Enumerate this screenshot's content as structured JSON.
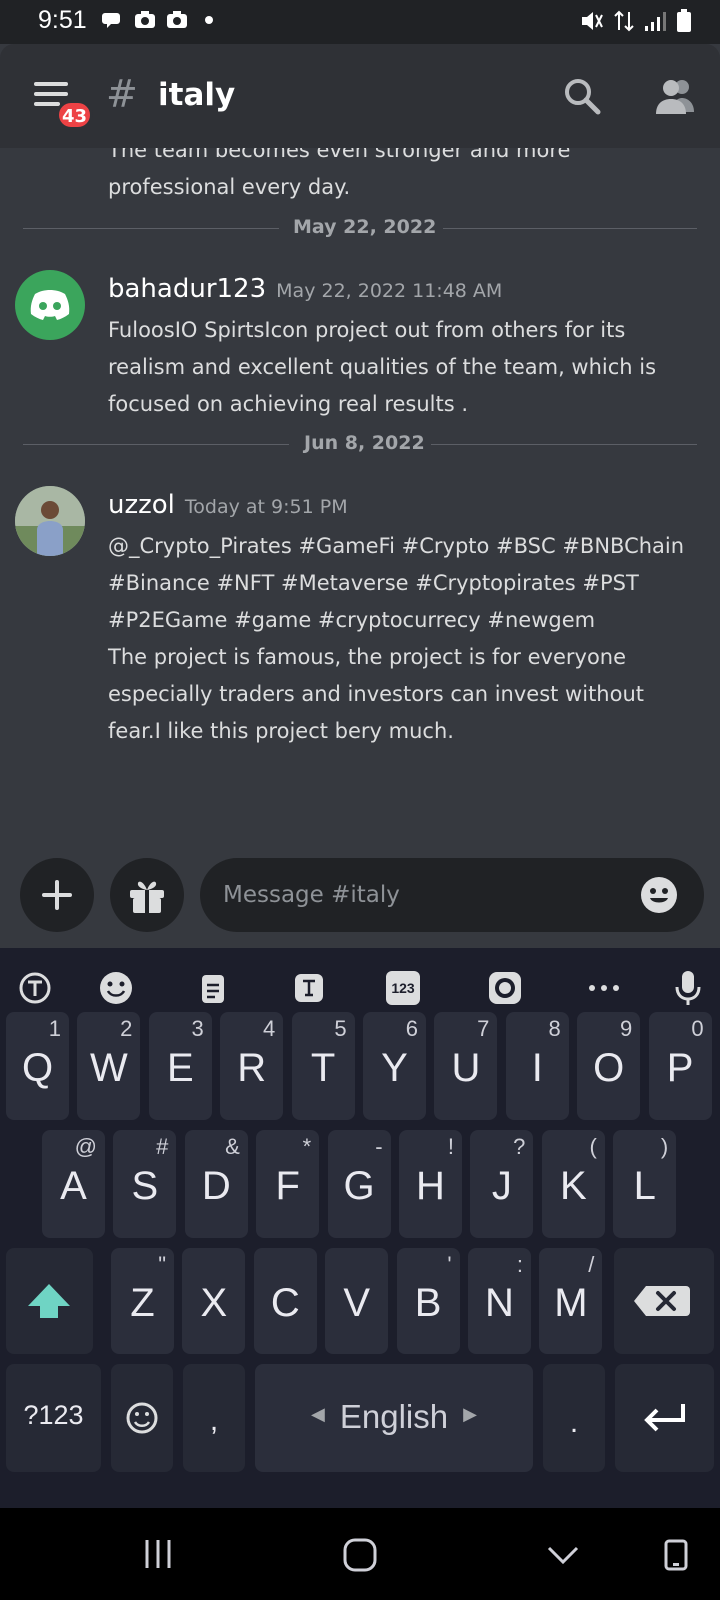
{
  "status_bar": {
    "time": "9:51"
  },
  "header": {
    "notification_badge": "43",
    "hash_symbol": "#",
    "channel_name": "italy"
  },
  "messages": {
    "partial_text": "The team becomes even stronger and more professional every day.",
    "dividers": [
      "May 22, 2022",
      "Jun 8, 2022"
    ],
    "items": [
      {
        "author": "bahadur123",
        "timestamp": "May 22, 2022 11:48 AM",
        "text": "FuloosIO SpirtsIcon project out from others for its realism and excellent qualities of the team, which is focused on achieving real results ."
      },
      {
        "author": "uzzol",
        "timestamp": "Today at 9:51 PM",
        "text": "@_Crypto_Pirates #GameFi #Crypto #BSC #BNBChain #Binance  #NFT #Metaverse #Cryptopirates #PST #P2EGame #game #cryptocurrecy #newgem\nThe project is famous, the project is for everyone especially traders and investors can invest without fear.I like this project bery much."
      }
    ]
  },
  "composer": {
    "placeholder": "Message #italy"
  },
  "keyboard": {
    "toolbar_123": "123",
    "row1": [
      {
        "k": "Q",
        "h": "1"
      },
      {
        "k": "W",
        "h": "2"
      },
      {
        "k": "E",
        "h": "3"
      },
      {
        "k": "R",
        "h": "4"
      },
      {
        "k": "T",
        "h": "5"
      },
      {
        "k": "Y",
        "h": "6"
      },
      {
        "k": "U",
        "h": "7"
      },
      {
        "k": "I",
        "h": "8"
      },
      {
        "k": "O",
        "h": "9"
      },
      {
        "k": "P",
        "h": "0"
      }
    ],
    "row2": [
      {
        "k": "A",
        "h": "@"
      },
      {
        "k": "S",
        "h": "#"
      },
      {
        "k": "D",
        "h": "&"
      },
      {
        "k": "F",
        "h": "*"
      },
      {
        "k": "G",
        "h": "-"
      },
      {
        "k": "H",
        "h": "!"
      },
      {
        "k": "J",
        "h": "?"
      },
      {
        "k": "K",
        "h": "("
      },
      {
        "k": "L",
        "h": ")"
      }
    ],
    "row3": [
      {
        "k": "Z",
        "h": "\""
      },
      {
        "k": "X",
        "h": ""
      },
      {
        "k": "C",
        "h": ""
      },
      {
        "k": "V",
        "h": ""
      },
      {
        "k": "B",
        "h": "'"
      },
      {
        "k": "N",
        "h": ":"
      },
      {
        "k": "M",
        "h": "/"
      }
    ],
    "symbols_key": "?123",
    "comma_key": ",",
    "space_label": "English",
    "period_key": "."
  },
  "colors": {
    "background": "#36393f",
    "header": "#2f3136",
    "discord_green": "#3ba55c",
    "badge_red": "#ed4245",
    "shift_teal": "#6fd4c4"
  }
}
